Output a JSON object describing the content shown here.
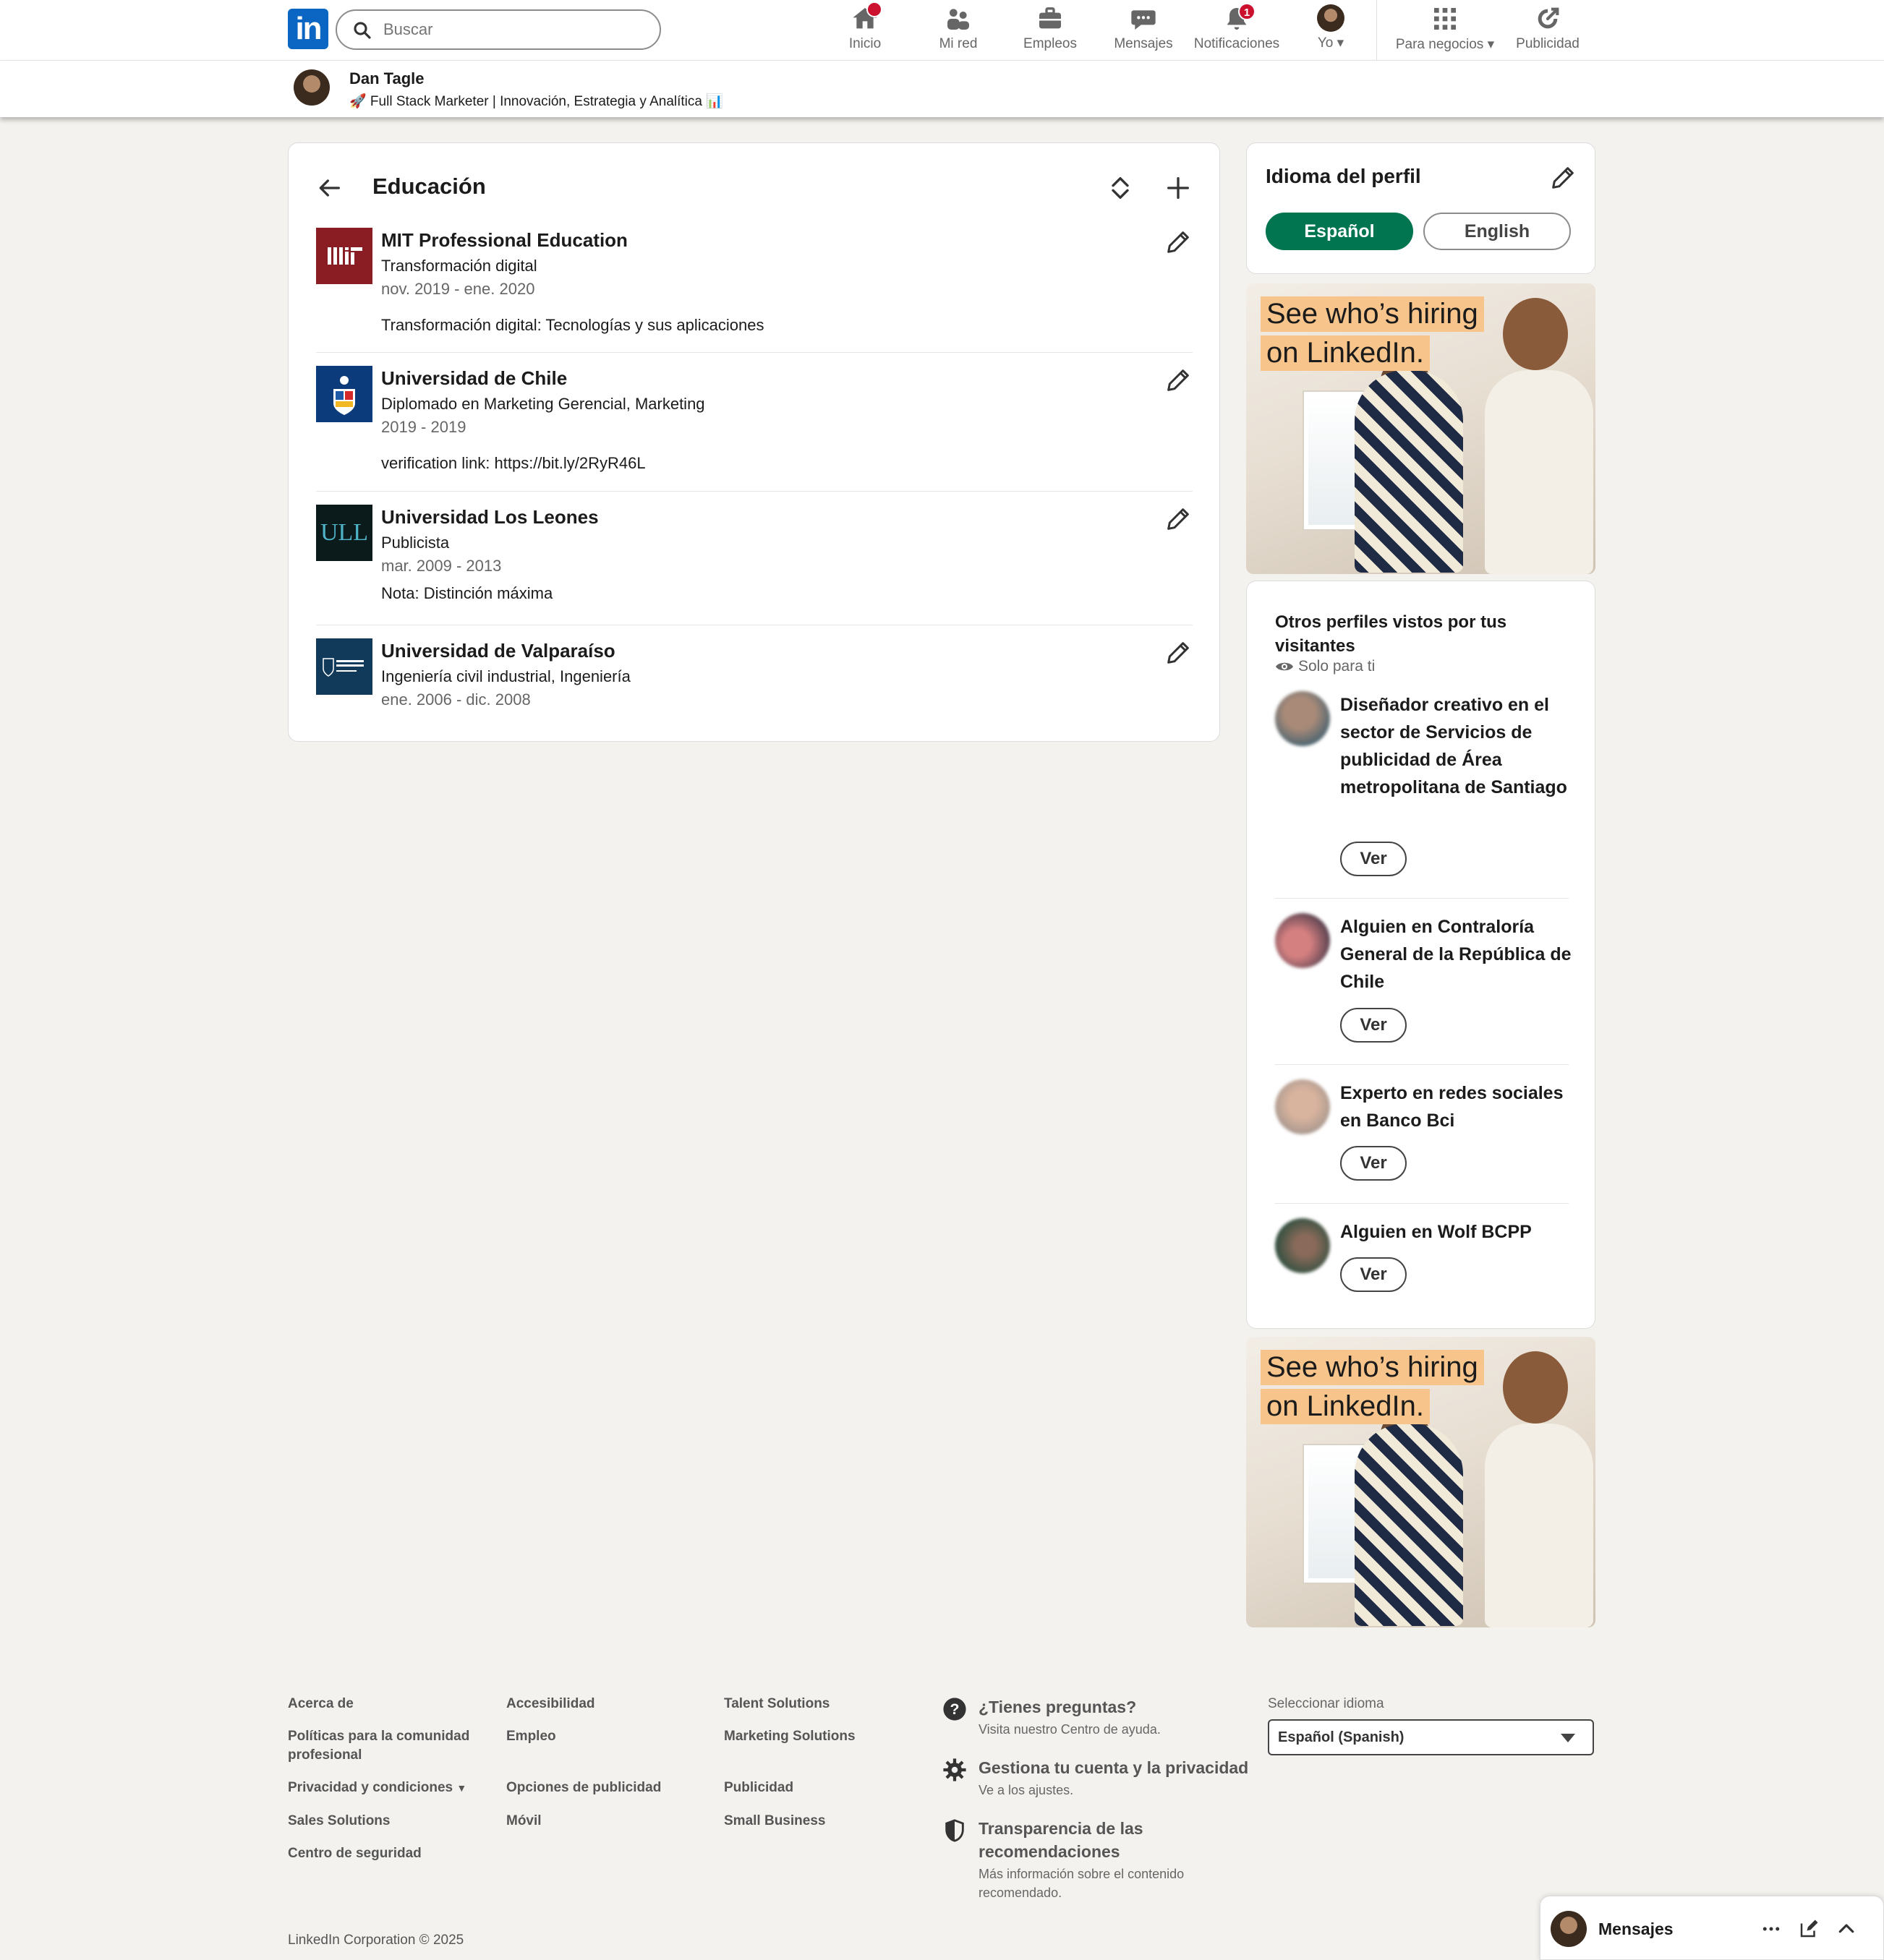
{
  "nav": {
    "logo_text": "in",
    "search_placeholder": "Buscar",
    "items": [
      {
        "label": "Inicio",
        "icon": "home-icon",
        "badge": ""
      },
      {
        "label": "Mi red",
        "icon": "network-icon",
        "badge": ""
      },
      {
        "label": "Empleos",
        "icon": "briefcase-icon",
        "badge": ""
      },
      {
        "label": "Mensajes",
        "icon": "chat-icon",
        "badge": ""
      },
      {
        "label": "Notificaciones",
        "icon": "bell-icon",
        "badge": "1"
      },
      {
        "label": "Yo",
        "icon": "avatar-icon",
        "badge": ""
      },
      {
        "label": "Para negocios",
        "icon": "grid-icon",
        "badge": ""
      },
      {
        "label": "Publicidad",
        "icon": "megaphone-icon",
        "badge": ""
      }
    ]
  },
  "profile": {
    "name": "Dan Tagle",
    "headline": "🚀 Full Stack Marketer | Innovación, Estrategia y Analítica 📊"
  },
  "education": {
    "title": "Educación",
    "entries": [
      {
        "school": "MIT Professional Education",
        "degree": "Transformación digital",
        "dates": "nov. 2019 - ene. 2020",
        "description": "Transformación digital: Tecnologías y sus aplicaciones",
        "logo_text": "MIT",
        "logo_color": "#8a1c24"
      },
      {
        "school": "Universidad de Chile",
        "degree": "Diplomado en Marketing Gerencial, Marketing",
        "dates": "2019 - 2019",
        "description": "verification link: https://bit.ly/2RyR46L",
        "logo_text": "",
        "logo_color": "#0b3b7a"
      },
      {
        "school": "Universidad Los Leones",
        "degree": "Publicista",
        "dates": "mar. 2009 - 2013",
        "description": "Nota: Distinción máxima",
        "logo_text": "ULL",
        "logo_color": "#0b1a1a"
      },
      {
        "school": "Universidad de Valparaíso",
        "degree": "Ingeniería civil industrial, Ingeniería",
        "dates": "ene. 2006 - dic. 2008",
        "description": "",
        "logo_text": "Universidad de Valparaíso",
        "logo_color": "#113a5a"
      }
    ]
  },
  "profile_language": {
    "title": "Idioma del perfil",
    "options": [
      "Español",
      "English"
    ],
    "selected": "Español",
    "accent": "#01754f"
  },
  "ad": {
    "line1": "See who’s hiring",
    "line2": "on LinkedIn."
  },
  "visitors": {
    "title": "Otros perfiles vistos por tus visitantes",
    "subtitle": "Solo para ti",
    "button_label": "Ver",
    "items": [
      {
        "name": "Diseñador creativo en el sector de Servicios de publicidad de Área metropolitana de Santiago"
      },
      {
        "name": "Alguien en Contraloría General de la República de Chile"
      },
      {
        "name": "Experto en redes sociales en Banco Bci"
      },
      {
        "name": "Alguien en Wolf BCPP"
      }
    ]
  },
  "footer": {
    "col1": [
      "Acerca de",
      "Políticas para la comunidad profesional",
      "Privacidad y condiciones",
      "Sales Solutions",
      "Centro de seguridad"
    ],
    "col2": [
      "Accesibilidad",
      "Empleo",
      "Opciones de publicidad",
      "Móvil"
    ],
    "col3": [
      "Talent Solutions",
      "Marketing Solutions",
      "Publicidad",
      "Small Business"
    ],
    "help": [
      {
        "title": "¿Tienes preguntas?",
        "sub": "Visita nuestro Centro de ayuda.",
        "icon": "question-icon"
      },
      {
        "title": "Gestiona tu cuenta y la privacidad",
        "sub": "Ve a los ajustes.",
        "icon": "gear-icon"
      },
      {
        "title": "Transparencia de las recomendaciones",
        "sub": "Más información sobre el contenido recomendado.",
        "icon": "shield-icon"
      }
    ],
    "select_label": "Seleccionar idioma",
    "select_value": "Español (Spanish)",
    "copyright": "LinkedIn Corporation © 2025"
  },
  "messaging": {
    "title": "Mensajes"
  }
}
